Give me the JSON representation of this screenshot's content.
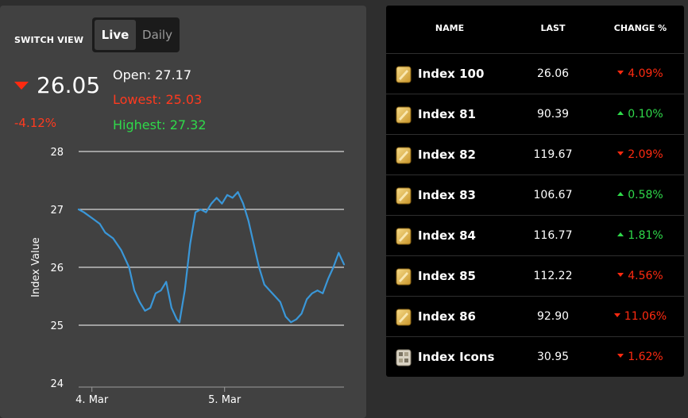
{
  "switch": {
    "label": "SWITCH VIEW",
    "options": [
      "Live",
      "Daily"
    ],
    "selected": "Live"
  },
  "quote": {
    "price": "26.05",
    "change_pct": "-4.12%",
    "direction": "down",
    "open": "Open: 27.17",
    "lowest": "Lowest: 25.03",
    "highest": "Highest: 27.32"
  },
  "colors": {
    "down": "#ff2a10",
    "up": "#2fd94a",
    "line": "#3a97d8",
    "panel": "#414141",
    "table_bg": "#000000"
  },
  "chart_data": {
    "type": "line",
    "ylabel": "Index Value",
    "xlabel": "",
    "ylim": [
      24,
      28
    ],
    "y_ticks": [
      24,
      25,
      26,
      27,
      28
    ],
    "x_ticks": [
      "4. Mar",
      "5. Mar"
    ],
    "x_tick_positions": [
      0.05,
      0.55
    ],
    "grid": true,
    "series": [
      {
        "name": "",
        "x": [
          0,
          0.02,
          0.05,
          0.08,
          0.1,
          0.13,
          0.16,
          0.19,
          0.21,
          0.23,
          0.25,
          0.27,
          0.29,
          0.31,
          0.33,
          0.35,
          0.37,
          0.38,
          0.4,
          0.42,
          0.44,
          0.46,
          0.48,
          0.5,
          0.52,
          0.54,
          0.56,
          0.58,
          0.6,
          0.62,
          0.64,
          0.66,
          0.68,
          0.7,
          0.72,
          0.74,
          0.76,
          0.78,
          0.8,
          0.82,
          0.84,
          0.86,
          0.88,
          0.9,
          0.92,
          0.94,
          0.96,
          0.98,
          1.0
        ],
        "values": [
          27.0,
          26.95,
          26.85,
          26.75,
          26.6,
          26.5,
          26.3,
          26.0,
          25.6,
          25.4,
          25.25,
          25.3,
          25.55,
          25.6,
          25.75,
          25.3,
          25.1,
          25.05,
          25.6,
          26.4,
          26.95,
          27.0,
          26.95,
          27.1,
          27.2,
          27.1,
          27.25,
          27.2,
          27.3,
          27.1,
          26.8,
          26.4,
          26.0,
          25.7,
          25.6,
          25.5,
          25.4,
          25.15,
          25.05,
          25.1,
          25.2,
          25.45,
          25.55,
          25.6,
          25.55,
          25.8,
          26.0,
          26.25,
          26.05
        ]
      }
    ]
  },
  "table": {
    "headers": {
      "name": "NAME",
      "last": "LAST",
      "change": "CHANGE %"
    },
    "rows": [
      {
        "icon": "gold-bar-icon",
        "name": "Index 100",
        "last": "26.06",
        "change": "4.09%",
        "dir": "down"
      },
      {
        "icon": "gold-bar-icon",
        "name": "Index 81",
        "last": "90.39",
        "change": "0.10%",
        "dir": "up"
      },
      {
        "icon": "gold-bar-icon",
        "name": "Index 82",
        "last": "119.67",
        "change": "2.09%",
        "dir": "down"
      },
      {
        "icon": "gold-bar-icon",
        "name": "Index 83",
        "last": "106.67",
        "change": "0.58%",
        "dir": "up"
      },
      {
        "icon": "gold-bar-icon",
        "name": "Index 84",
        "last": "116.77",
        "change": "1.81%",
        "dir": "up"
      },
      {
        "icon": "gold-bar-icon",
        "name": "Index 85",
        "last": "112.22",
        "change": "4.56%",
        "dir": "down"
      },
      {
        "icon": "gold-bar-icon",
        "name": "Index 86",
        "last": "92.90",
        "change": "11.06%",
        "dir": "down"
      },
      {
        "icon": "icons-grid-icon",
        "name": "Index Icons",
        "last": "30.95",
        "change": "1.62%",
        "dir": "down"
      }
    ]
  }
}
